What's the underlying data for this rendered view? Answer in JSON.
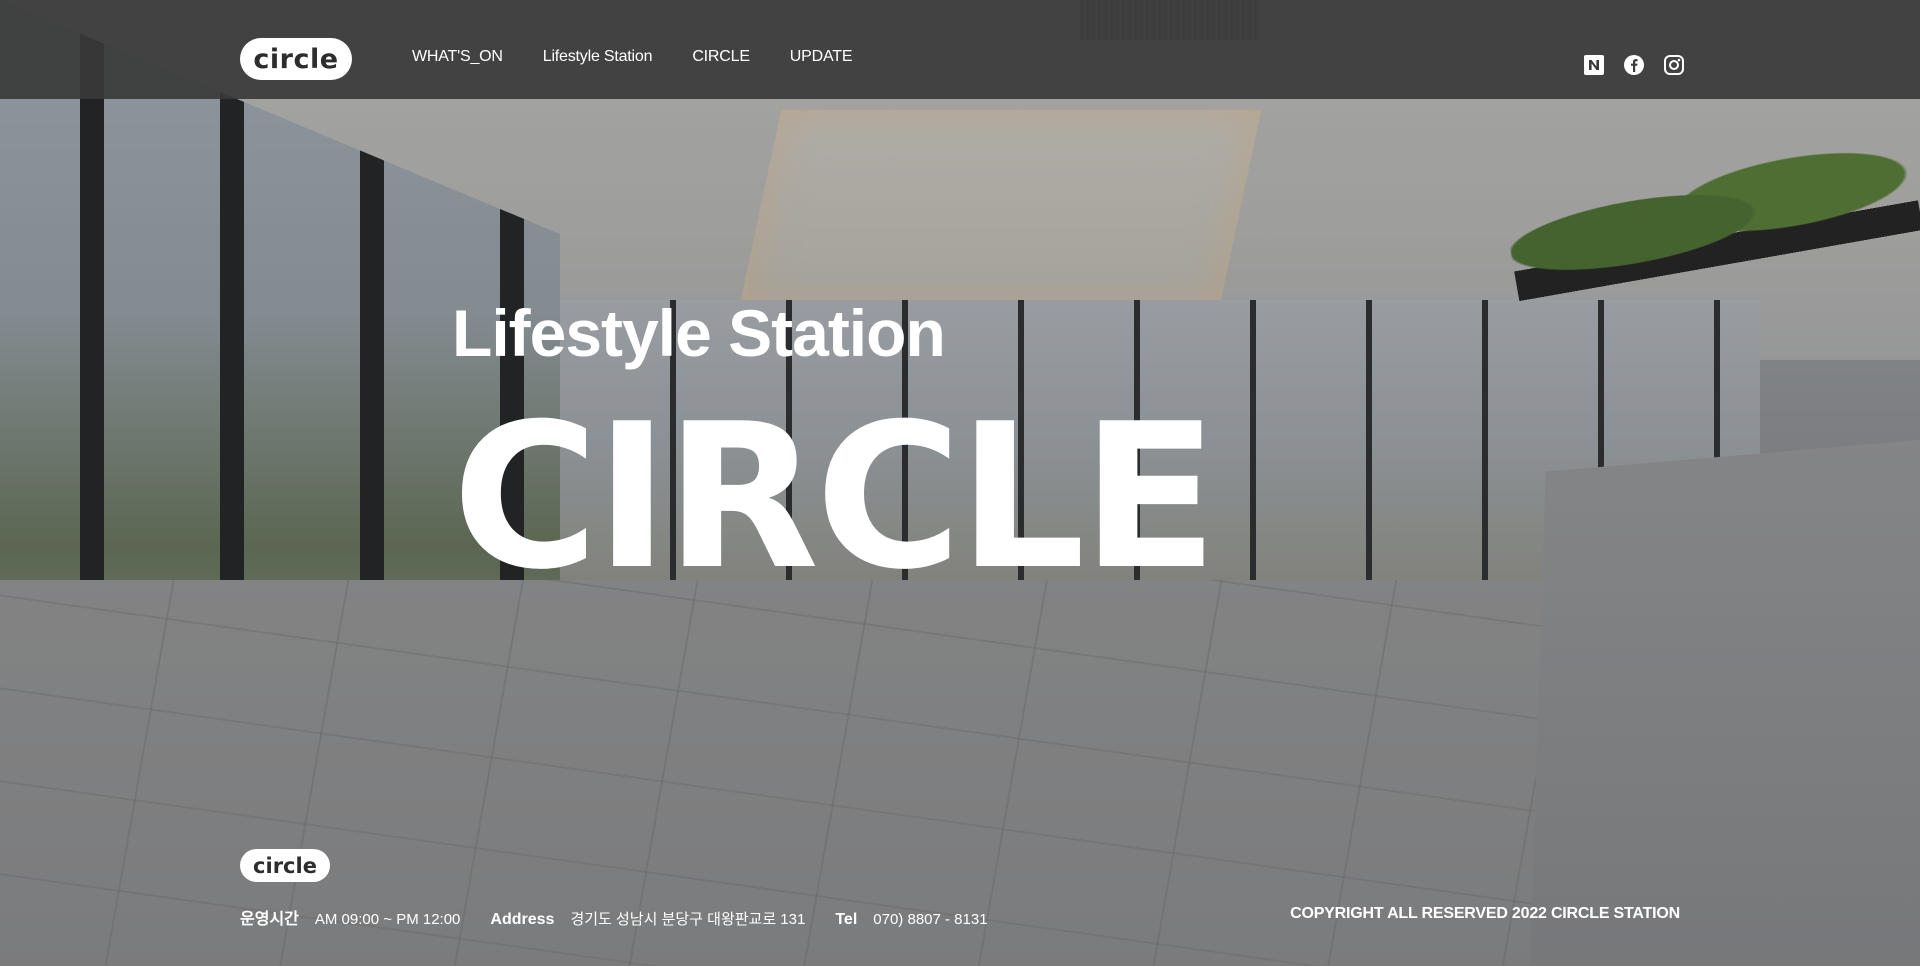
{
  "header": {
    "logo_text": "circle",
    "nav": [
      {
        "label": "WHAT'S_ON"
      },
      {
        "label": "Lifestyle Station"
      },
      {
        "label": "CIRCLE"
      },
      {
        "label": "UPDATE"
      }
    ],
    "social": [
      {
        "icon": "naver-icon",
        "glyph": "N"
      },
      {
        "icon": "facebook-icon",
        "glyph": "f"
      },
      {
        "icon": "instagram-icon",
        "glyph": ""
      }
    ]
  },
  "hero": {
    "subtitle": "Lifestyle Station",
    "title": "CIRCLE"
  },
  "footer": {
    "logo_text": "circle",
    "hours_label": "운영시간",
    "hours_value": "AM 09:00 ~ PM 12:00",
    "address_label": "Address",
    "address_value": "경기도 성남시 분당구 대왕판교로 131",
    "tel_label": "Tel",
    "tel_value": "070) 8807 - 8131",
    "copyright": "COPYRIGHT ALL RESERVED 2022 CIRCLE STATION"
  },
  "colors": {
    "header_bg": "#3a3a3a",
    "text": "#ffffff",
    "logo_bg": "#ffffff",
    "logo_text": "#2c2c2c"
  }
}
